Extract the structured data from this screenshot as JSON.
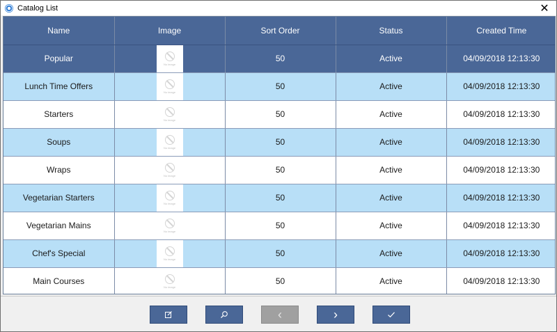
{
  "window": {
    "title": "Catalog List",
    "close_glyph": "✕"
  },
  "table": {
    "columns": [
      "Name",
      "Image",
      "Sort Order",
      "Status",
      "Created Time"
    ],
    "no_image_text": "No image",
    "rows": [
      {
        "name": "Popular",
        "sort_order": "50",
        "status": "Active",
        "created": "04/09/2018 12:13:30"
      },
      {
        "name": "Lunch Time Offers",
        "sort_order": "50",
        "status": "Active",
        "created": "04/09/2018 12:13:30"
      },
      {
        "name": "Starters",
        "sort_order": "50",
        "status": "Active",
        "created": "04/09/2018 12:13:30"
      },
      {
        "name": "Soups",
        "sort_order": "50",
        "status": "Active",
        "created": "04/09/2018 12:13:30"
      },
      {
        "name": "Wraps",
        "sort_order": "50",
        "status": "Active",
        "created": "04/09/2018 12:13:30"
      },
      {
        "name": "Vegetarian Starters",
        "sort_order": "50",
        "status": "Active",
        "created": "04/09/2018 12:13:30"
      },
      {
        "name": "Vegetarian Mains",
        "sort_order": "50",
        "status": "Active",
        "created": "04/09/2018 12:13:30"
      },
      {
        "name": "Chef's Special",
        "sort_order": "50",
        "status": "Active",
        "created": "04/09/2018 12:13:30"
      },
      {
        "name": "Main Courses",
        "sort_order": "50",
        "status": "Active",
        "created": "04/09/2018 12:13:30"
      }
    ]
  },
  "toolbar": {
    "buttons": [
      {
        "icon": "edit-icon",
        "enabled": true
      },
      {
        "icon": "search-icon",
        "enabled": true
      },
      {
        "icon": "chevron-left-icon",
        "glyph": "‹",
        "enabled": false
      },
      {
        "icon": "chevron-right-icon",
        "glyph": "›",
        "enabled": true
      },
      {
        "icon": "checkmark-icon",
        "enabled": true
      }
    ]
  },
  "colors": {
    "header_bg": "#4a6797",
    "selected_row_bg": "#4a6797",
    "alt_row_bg": "#b8dff7",
    "row_bg": "#ffffff",
    "button_bg": "#4a6797",
    "button_disabled_bg": "#a0a0a0"
  }
}
